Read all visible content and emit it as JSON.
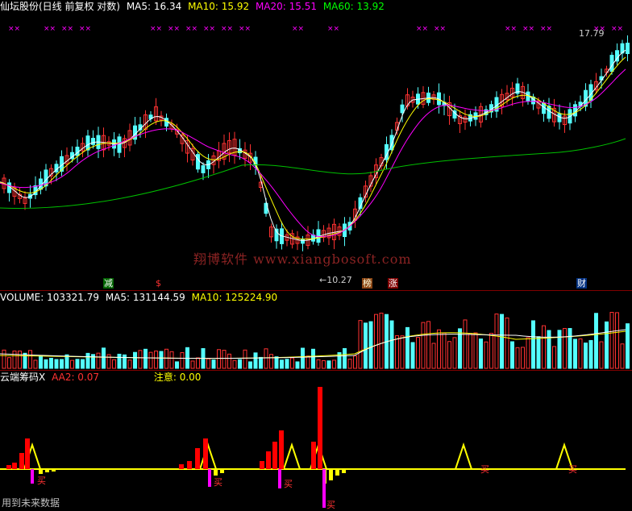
{
  "main_panel": {
    "title": "仙坛股份(日线 前复权 对数)",
    "ma5": "MA5: 16.34",
    "ma10": "MA10: 15.92",
    "ma20": "MA20: 15.51",
    "ma60": "MA60: 13.92",
    "high_label": "17.79",
    "low_label": "←10.27",
    "watermark": "翔博软件 www.xiangbosoft.com",
    "badges": [
      "减",
      "$",
      "榜",
      "涨",
      "财"
    ],
    "colors": {
      "ma5": "#ffffff",
      "ma10": "#ffff00",
      "ma20": "#ff00ff",
      "ma60": "#00c000",
      "up": "#ff3232",
      "down": "#54ffff"
    }
  },
  "volume_panel": {
    "volume": "VOLUME: 103321.79",
    "ma5": "MA5: 131144.59",
    "ma10": "MA10: 125224.90"
  },
  "indicator_panel": {
    "name": "云端筹码X",
    "aa2": "AA2: 0.07",
    "notice": "注意: 0.00",
    "buy_label": "买",
    "footer": "用到未来数据"
  }
}
